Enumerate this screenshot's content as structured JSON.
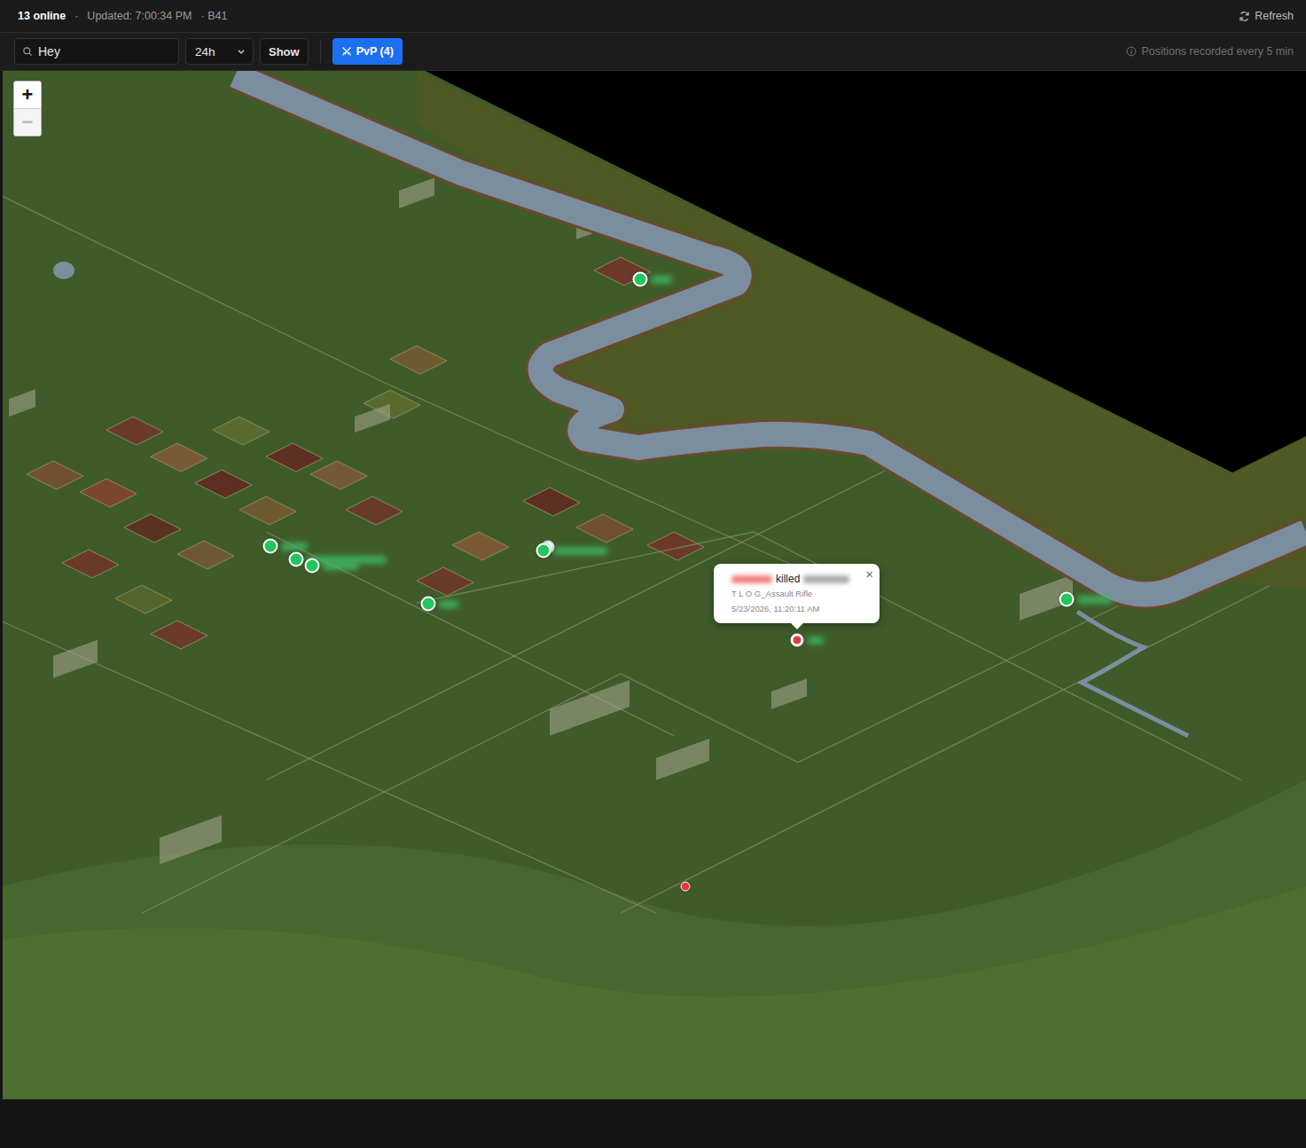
{
  "status_bar": {
    "online": "13 online",
    "separator": "·",
    "updated": "Updated: 7:00:34 PM",
    "build": "· B41",
    "refresh": "Refresh"
  },
  "toolbar": {
    "search": {
      "value": "Hey"
    },
    "range": {
      "value": "24h"
    },
    "show": "Show",
    "pvp": {
      "label": "PvP (4)",
      "selected": true
    },
    "info": "Positions recorded every 5 min"
  },
  "zoom": {
    "in": "+",
    "out": "−",
    "out_disabled": true
  },
  "map": {
    "markers": [
      {
        "kind": "player",
        "color": "#22c55e",
        "selected": false
      },
      {
        "kind": "player",
        "color": "#22c55e",
        "selected": false
      },
      {
        "kind": "player",
        "color": "#22c55e",
        "selected": false
      },
      {
        "kind": "player",
        "color": "#22c55e",
        "selected": false
      },
      {
        "kind": "player",
        "color": "#22c55e",
        "selected": false
      },
      {
        "kind": "player",
        "color": "#22c55e",
        "selected": false
      },
      {
        "kind": "player",
        "color": "#22c55e",
        "selected": false
      },
      {
        "kind": "kill",
        "color": "#e5393b",
        "selected": true
      },
      {
        "kind": "kill",
        "color": "#e5393b",
        "selected": false
      }
    ]
  },
  "popup": {
    "verb": "killed",
    "weapon": "T L O G_Assault Rifle",
    "time": "5/23/2026, 11:20:11 AM",
    "close": "×"
  }
}
